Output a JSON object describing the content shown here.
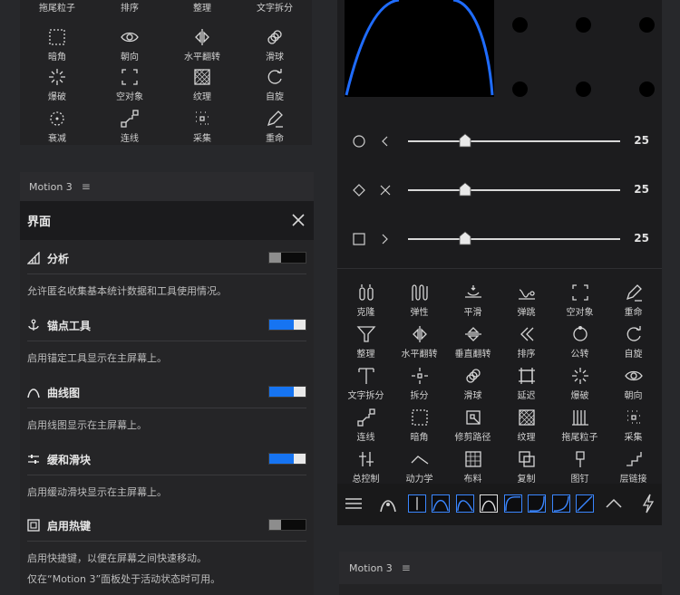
{
  "top_tools": [
    {
      "label": "拖尾粒子"
    },
    {
      "label": "排序"
    },
    {
      "label": "整理"
    },
    {
      "label": "文字拆分"
    },
    {
      "label": "暗角",
      "icon": "vignette-icon"
    },
    {
      "label": "朝向",
      "icon": "eye-icon"
    },
    {
      "label": "水平翻转",
      "icon": "flip-h-icon"
    },
    {
      "label": "滑球",
      "icon": "sliding-balls-icon"
    },
    {
      "label": "爆破",
      "icon": "explode-icon"
    },
    {
      "label": "空对象",
      "icon": "null-object-icon"
    },
    {
      "label": "纹理",
      "icon": "texture-icon"
    },
    {
      "label": "自旋",
      "icon": "spin-icon"
    },
    {
      "label": "衰减",
      "icon": "decay-icon"
    },
    {
      "label": "连线",
      "icon": "connect-icon"
    },
    {
      "label": "采集",
      "icon": "collect-icon"
    },
    {
      "label": "重命",
      "icon": "rename-icon"
    }
  ],
  "settings": {
    "panel_name": "Motion 3",
    "menu_glyph": "≡",
    "title": "界面",
    "rows": [
      {
        "name": "analysis",
        "label": "分析",
        "desc": "允许匿名收集基本统计数据和工具使用情况。",
        "on": false
      },
      {
        "name": "anchor-tool",
        "label": "锚点工具",
        "desc": "启用锚定工具显示在主屏幕上。",
        "on": true
      },
      {
        "name": "curve-graph",
        "label": "曲线图",
        "desc": "启用线图显示在主屏幕上。",
        "on": true
      },
      {
        "name": "ease-slider",
        "label": "缓和滑块",
        "desc": "启用缓动滑块显示在主屏幕上。",
        "on": true
      },
      {
        "name": "hotkeys",
        "label": "启用热键",
        "desc": "启用快捷键，以便在屏幕之间快速移动。",
        "on": false
      }
    ],
    "footnote": "仅在“Motion 3”面板处于活动状态时可用。"
  },
  "sliders": [
    {
      "value": "25",
      "pos": 0.27
    },
    {
      "value": "25",
      "pos": 0.27
    },
    {
      "value": "25",
      "pos": 0.27
    }
  ],
  "right_tools": [
    {
      "label": "克隆",
      "icon": "clone-icon"
    },
    {
      "label": "弹性",
      "icon": "elastic-icon"
    },
    {
      "label": "平滑",
      "icon": "smooth-icon"
    },
    {
      "label": "弹跳",
      "icon": "bounce-icon"
    },
    {
      "label": "空对象",
      "icon": "null-object-icon"
    },
    {
      "label": "重命",
      "icon": "rename-icon"
    },
    {
      "label": "整理",
      "icon": "funnel-icon"
    },
    {
      "label": "水平翻转",
      "icon": "flip-h-icon"
    },
    {
      "label": "垂直翻转",
      "icon": "flip-v-icon"
    },
    {
      "label": "排序",
      "icon": "sort-icon"
    },
    {
      "label": "公转",
      "icon": "orbit-icon"
    },
    {
      "label": "自旋",
      "icon": "spin-icon"
    },
    {
      "label": "文字拆分",
      "icon": "text-split-icon"
    },
    {
      "label": "拆分",
      "icon": "split-icon"
    },
    {
      "label": "滑球",
      "icon": "sliding-balls-icon"
    },
    {
      "label": "延迟",
      "icon": "delay-icon"
    },
    {
      "label": "爆破",
      "icon": "explode-icon"
    },
    {
      "label": "朝向",
      "icon": "eye-icon"
    },
    {
      "label": "连线",
      "icon": "connect-icon"
    },
    {
      "label": "暗角",
      "icon": "vignette-icon"
    },
    {
      "label": "修剪路径",
      "icon": "trim-path-icon"
    },
    {
      "label": "纹理",
      "icon": "texture-icon"
    },
    {
      "label": "拖尾粒子",
      "icon": "trail-icon"
    },
    {
      "label": "采集",
      "icon": "collect-icon"
    },
    {
      "label": "总控制",
      "icon": "master-control-icon"
    },
    {
      "label": "动力学",
      "icon": "dynamics-icon"
    },
    {
      "label": "布料",
      "icon": "cloth-icon"
    },
    {
      "label": "复制",
      "icon": "copy-icon"
    },
    {
      "label": "图钉",
      "icon": "pin-icon"
    },
    {
      "label": "层链接",
      "icon": "layer-link-icon"
    }
  ],
  "bottom_panel": {
    "panel_name": "Motion 3"
  },
  "colors": {
    "accent": "#1674f2",
    "panel": "#1c1c1e",
    "bg": "#27282b"
  }
}
